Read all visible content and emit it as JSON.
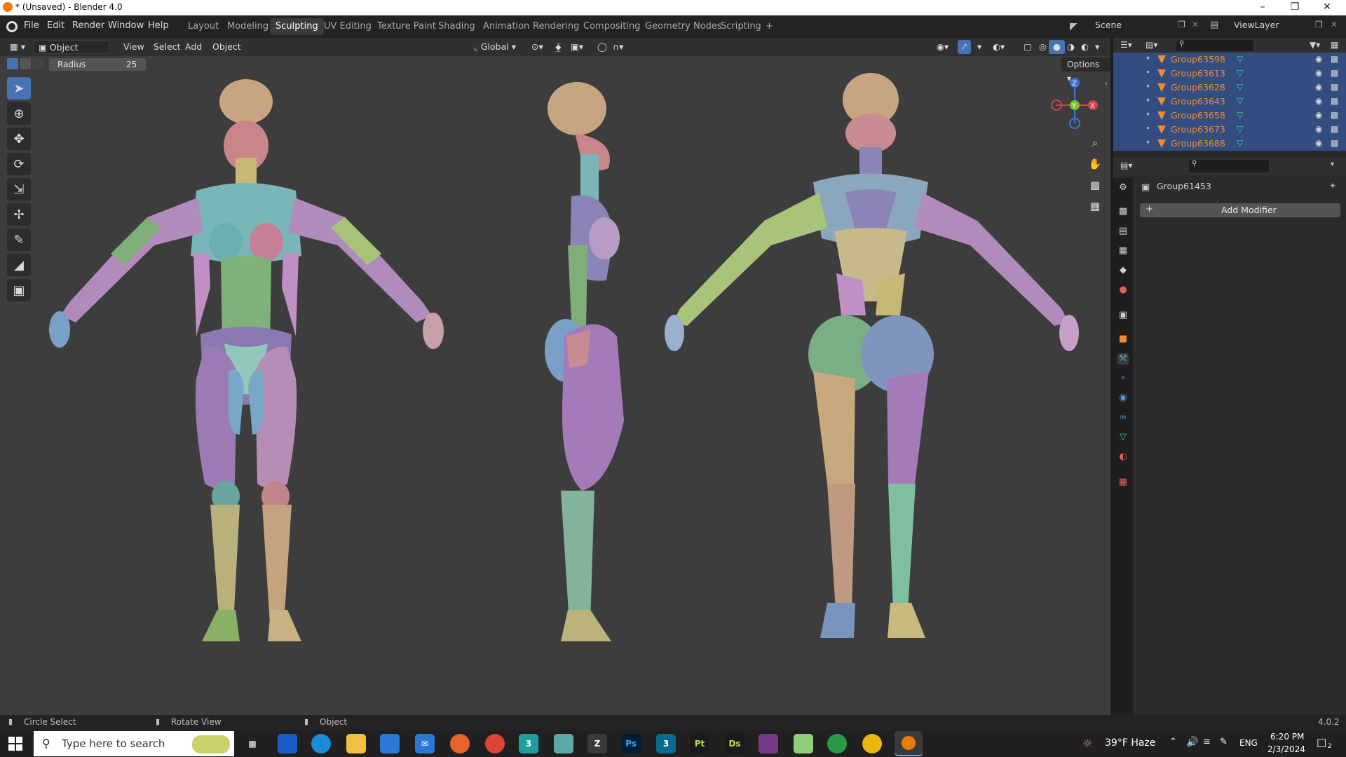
{
  "window": {
    "title": "* (Unsaved) - Blender 4.0"
  },
  "menu": [
    "File",
    "Edit",
    "Render",
    "Window",
    "Help"
  ],
  "workspaces": [
    {
      "label": "Layout",
      "active": false
    },
    {
      "label": "Modeling",
      "active": false
    },
    {
      "label": "Sculpting",
      "active": true
    },
    {
      "label": "UV Editing",
      "active": false
    },
    {
      "label": "Texture Paint",
      "active": false
    },
    {
      "label": "Shading",
      "active": false
    },
    {
      "label": "Animation",
      "active": false
    },
    {
      "label": "Rendering",
      "active": false
    },
    {
      "label": "Compositing",
      "active": false
    },
    {
      "label": "Geometry Nodes",
      "active": false
    },
    {
      "label": "Scripting",
      "active": false
    }
  ],
  "add_workspace": "+",
  "scene": {
    "label": "Scene"
  },
  "view_layer": {
    "label": "ViewLayer"
  },
  "viewport_header": {
    "mode": "Object Mode",
    "view": "View",
    "select": "Select",
    "add": "Add",
    "object": "Object",
    "orientation": "Global"
  },
  "tool_settings": {
    "radius_label": "Radius",
    "radius_value": "25"
  },
  "options_label": "Options",
  "gizmo": {
    "z": "Z",
    "y": "Y",
    "x": "X"
  },
  "outliner": {
    "items": [
      "Group63598",
      "Group63613",
      "Group63628",
      "Group63643",
      "Group63658",
      "Group63673",
      "Group63688"
    ]
  },
  "properties": {
    "object_name": "Group61453",
    "add_modifier": "Add Modifier"
  },
  "status": {
    "left": "Circle Select",
    "middle": "Rotate View",
    "right": "Object",
    "version": "4.0.2"
  },
  "taskbar": {
    "search_placeholder": "Type here to search",
    "weather": "39°F  Haze",
    "lang": "ENG",
    "time": "6:20 PM",
    "date": "2/3/2024",
    "notif_count": "2",
    "apps": [
      {
        "name": "ps",
        "label": "Ps",
        "color": "#001e36",
        "fg": "#31a8ff"
      },
      {
        "name": "3dsmax",
        "label": "3",
        "color": "#0a6b8f",
        "fg": "#ffffff"
      },
      {
        "name": "pt",
        "label": "Pt",
        "color": "#1a1a1a",
        "fg": "#b7e04b"
      },
      {
        "name": "ds",
        "label": "Ds",
        "color": "#1a1a1a",
        "fg": "#b7e04b"
      }
    ]
  }
}
